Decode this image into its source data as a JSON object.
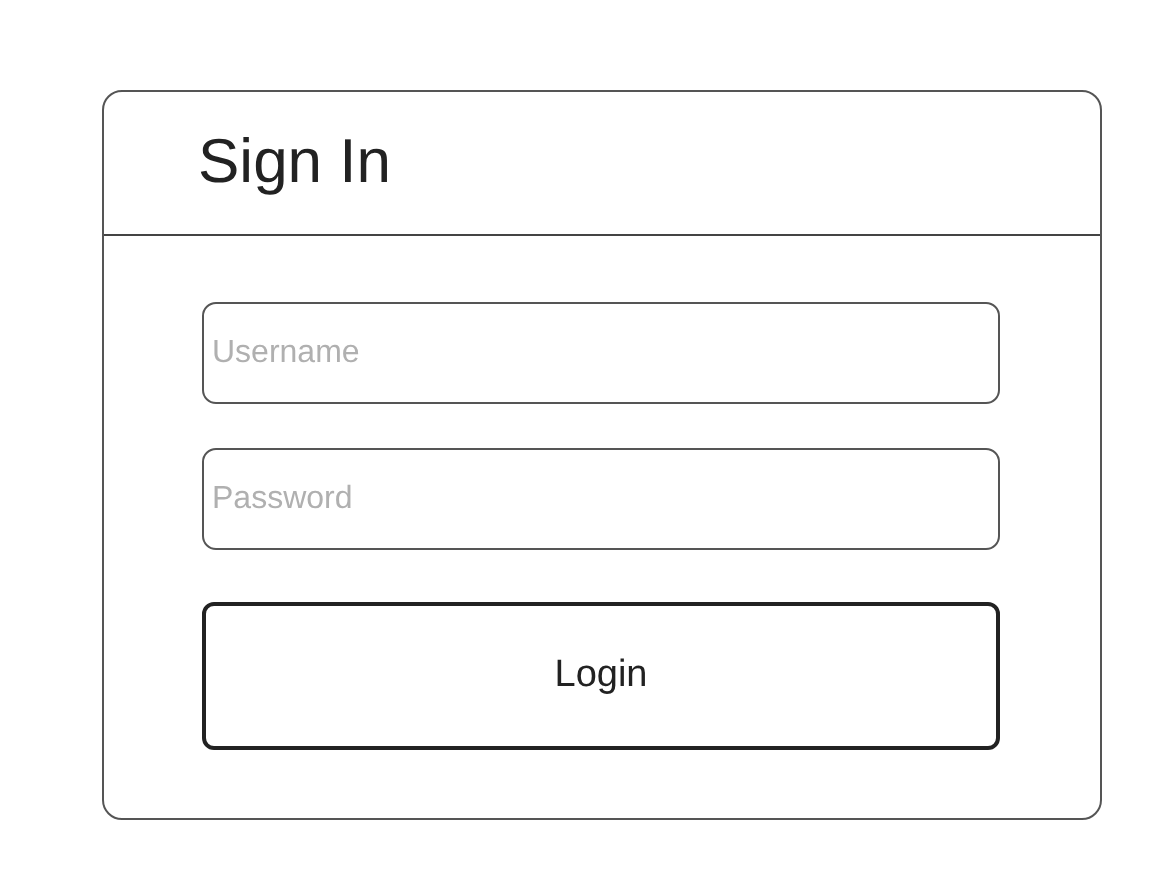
{
  "title": "Sign In",
  "fields": [
    {
      "placeholder": "Username"
    },
    {
      "placeholder": "Password"
    }
  ],
  "button": "Login"
}
